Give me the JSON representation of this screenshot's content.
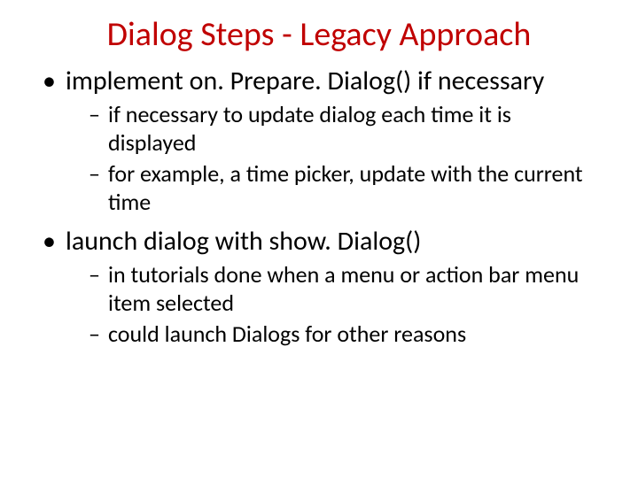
{
  "title_color": "#c00000",
  "slide": {
    "title": "Dialog Steps - Legacy Approach",
    "bullets": [
      {
        "text": "implement on. Prepare. Dialog() if necessary",
        "sub": [
          "if necessary to update dialog each time it is displayed",
          "for example, a time picker, update with the current time"
        ]
      },
      {
        "text": "launch dialog with show. Dialog()",
        "sub": [
          "in tutorials done when a menu or action bar menu item selected",
          "could launch Dialogs for other reasons"
        ]
      }
    ]
  }
}
